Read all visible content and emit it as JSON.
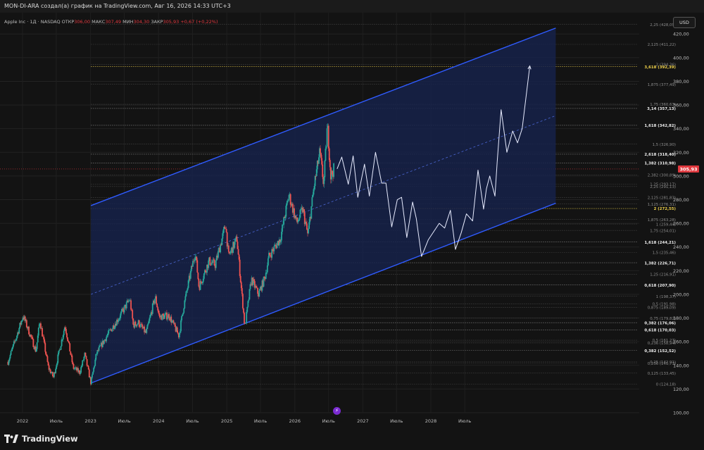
{
  "header": {
    "title": "MON-DI-ARA создал(а) график на TradingView.com, Авг 16, 2026 14:33 UTC+3"
  },
  "legend": {
    "symbol": "Apple Inc · 1Д · NASDAQ",
    "open_label": "ОТКР",
    "open_value": "306,00",
    "high_label": "МАКС",
    "high_value": "307,49",
    "low_label": "МИН",
    "low_value": "304,30",
    "close_label": "ЗАКР",
    "close_value": "305,93",
    "change": "+0,67 (+0,22%)"
  },
  "currency_button": "USD",
  "logo_text": "TradingView",
  "colors": {
    "background": "#131313",
    "channel_line": "#2f5bff",
    "channel_fill": "#16224a",
    "candle_up": "#26a69a",
    "candle_down": "#ef5350",
    "projection": "#e8ecff",
    "price_tag": "#e0383e",
    "fib_highlight": "#f0d24a"
  },
  "chart_data": {
    "type": "candlestick",
    "symbol": "AAPL",
    "timeframe": "1D",
    "ylim": [
      100,
      438
    ],
    "y_ticks": [
      "100,00",
      "120,00",
      "140,00",
      "160,00",
      "180,00",
      "200,00",
      "220,00",
      "240,00",
      "260,00",
      "280,00",
      "300,00",
      "320,00",
      "340,00",
      "360,00",
      "380,00",
      "400,00",
      "420,00"
    ],
    "x_ticks": [
      "2022",
      "Июль",
      "2023",
      "Июль",
      "2024",
      "Июль",
      "2025",
      "Июль",
      "2026",
      "Июль",
      "2027",
      "Июль",
      "2028",
      "Июль"
    ],
    "last_price": "305,93",
    "price_path": [
      [
        "2021-10-15",
        143
      ],
      [
        "2021-12-01",
        165
      ],
      [
        "2022-01-04",
        182
      ],
      [
        "2022-02-01",
        170
      ],
      [
        "2022-03-14",
        152
      ],
      [
        "2022-04-04",
        178
      ],
      [
        "2022-05-20",
        138
      ],
      [
        "2022-06-16",
        130
      ],
      [
        "2022-08-17",
        174
      ],
      [
        "2022-09-30",
        138
      ],
      [
        "2022-11-04",
        134
      ],
      [
        "2022-12-01",
        149
      ],
      [
        "2023-01-03",
        125
      ],
      [
        "2023-02-02",
        150
      ],
      [
        "2023-04-03",
        166
      ],
      [
        "2023-06-01",
        180
      ],
      [
        "2023-07-31",
        196
      ],
      [
        "2023-08-18",
        174
      ],
      [
        "2023-09-15",
        176
      ],
      [
        "2023-10-26",
        167
      ],
      [
        "2023-12-14",
        198
      ],
      [
        "2024-01-05",
        181
      ],
      [
        "2024-02-26",
        182
      ],
      [
        "2024-04-19",
        165
      ],
      [
        "2024-05-15",
        190
      ],
      [
        "2024-06-14",
        213
      ],
      [
        "2024-07-16",
        236
      ],
      [
        "2024-08-05",
        206
      ],
      [
        "2024-09-27",
        228
      ],
      [
        "2024-10-31",
        225
      ],
      [
        "2024-12-26",
        259
      ],
      [
        "2025-01-10",
        232
      ],
      [
        "2025-02-24",
        247
      ],
      [
        "2025-04-08",
        172
      ],
      [
        "2025-05-13",
        213
      ],
      [
        "2025-06-20",
        200
      ],
      [
        "2025-07-24",
        214
      ],
      [
        "2025-08-15",
        232
      ],
      [
        "2025-10-15",
        247
      ],
      [
        "2025-12-01",
        284
      ],
      [
        "2026-01-12",
        260
      ],
      [
        "2026-02-12",
        272
      ],
      [
        "2026-03-12",
        250
      ],
      [
        "2026-04-15",
        292
      ],
      [
        "2026-05-15",
        320
      ],
      [
        "2026-06-05",
        293
      ],
      [
        "2026-06-25",
        343
      ],
      [
        "2026-07-13",
        300
      ],
      [
        "2026-07-31",
        306
      ]
    ],
    "projection_path": [
      [
        "2026-08-16",
        306
      ],
      [
        "2026-09-10",
        316
      ],
      [
        "2026-10-15",
        293
      ],
      [
        "2026-11-10",
        317
      ],
      [
        "2026-12-05",
        282
      ],
      [
        "2027-01-10",
        310
      ],
      [
        "2027-02-05",
        283
      ],
      [
        "2027-03-10",
        320
      ],
      [
        "2027-04-12",
        294
      ],
      [
        "2027-05-05",
        294
      ],
      [
        "2027-06-05",
        257
      ],
      [
        "2027-07-05",
        280
      ],
      [
        "2027-07-28",
        282
      ],
      [
        "2027-08-25",
        248
      ],
      [
        "2027-09-25",
        278
      ],
      [
        "2027-10-15",
        264
      ],
      [
        "2027-11-12",
        232
      ],
      [
        "2027-12-18",
        246
      ],
      [
        "2028-02-15",
        260
      ],
      [
        "2028-03-15",
        256
      ],
      [
        "2028-04-15",
        271
      ],
      [
        "2028-05-12",
        238
      ],
      [
        "2028-06-12",
        252
      ],
      [
        "2028-07-10",
        268
      ],
      [
        "2028-08-12",
        262
      ],
      [
        "2028-09-10",
        305
      ],
      [
        "2028-10-10",
        272
      ],
      [
        "2028-10-25",
        289
      ],
      [
        "2028-11-12",
        300
      ],
      [
        "2028-12-10",
        283
      ],
      [
        "2028-12-22",
        312
      ],
      [
        "2029-01-12",
        356
      ],
      [
        "2029-02-12",
        320
      ],
      [
        "2029-03-15",
        338
      ],
      [
        "2029-04-10",
        328
      ],
      [
        "2029-05-05",
        340
      ],
      [
        "2029-06-15",
        393
      ]
    ],
    "channel": {
      "lower": [
        [
          "2023-01-03",
          125
        ],
        [
          "2029-11-01",
          277
        ]
      ],
      "upper": [
        [
          "2023-01-03",
          275
        ],
        [
          "2029-11-01",
          425
        ]
      ],
      "median": [
        [
          "2023-01-03",
          200
        ],
        [
          "2029-11-01",
          351
        ]
      ]
    },
    "fib_levels": [
      {
        "label": "2,25 (428,09)",
        "value": 428.09,
        "style": "dim"
      },
      {
        "label": "2,125 (411,22)",
        "value": 411.22,
        "style": "dim"
      },
      {
        "label": "2 (394,36)",
        "value": 394.36,
        "style": "dim"
      },
      {
        "label": "3,618 (392,39)",
        "value": 392.39,
        "style": "gold"
      },
      {
        "label": "1,875 (377,49)",
        "value": 377.49,
        "style": "dim"
      },
      {
        "label": "1,75 (360,63)",
        "value": 360.63,
        "style": "dim"
      },
      {
        "label": "3,14 (357,13)",
        "value": 357.13,
        "style": "bright"
      },
      {
        "label": "1,618 (342,82)",
        "value": 342.82,
        "style": "bright"
      },
      {
        "label": "1,5 (326,90)",
        "value": 326.9,
        "style": "dim"
      },
      {
        "label": "2,618 (318,40)",
        "value": 318.4,
        "style": "bright"
      },
      {
        "label": "1,382 (310,98)",
        "value": 310.98,
        "style": "bright"
      },
      {
        "label": "2,382 (300,89)",
        "value": 300.89,
        "style": "dim"
      },
      {
        "label": "1,25 (293,17)",
        "value": 293.17,
        "style": "dim"
      },
      {
        "label": "2,25 (291,13)",
        "value": 291.13,
        "style": "dim"
      },
      {
        "label": "2,125 (281,83)",
        "value": 281.83,
        "style": "dim"
      },
      {
        "label": "1,125 (276,31)",
        "value": 276.31,
        "style": "dim"
      },
      {
        "label": "2 (272,55)",
        "value": 272.55,
        "style": "gold"
      },
      {
        "label": "1,875 (263,28)",
        "value": 263.28,
        "style": "dim"
      },
      {
        "label": "1 (259,44)",
        "value": 259.44,
        "style": "dim"
      },
      {
        "label": "1,75 (254,01)",
        "value": 254.01,
        "style": "dim"
      },
      {
        "label": "1,618 (244,21)",
        "value": 244.21,
        "style": "bright"
      },
      {
        "label": "1,5 (235,46)",
        "value": 235.46,
        "style": "dim"
      },
      {
        "label": "1,382 (226,71)",
        "value": 226.71,
        "style": "bright"
      },
      {
        "label": "1,25 (216,91)",
        "value": 216.91,
        "style": "dim"
      },
      {
        "label": "0,618 (207,90)",
        "value": 207.9,
        "style": "bright"
      },
      {
        "label": "1 (198,37)",
        "value": 198.37,
        "style": "dim"
      },
      {
        "label": "0,5 (191,98)",
        "value": 191.98,
        "style": "dim"
      },
      {
        "label": "0,875 (189,09)",
        "value": 189.09,
        "style": "dim"
      },
      {
        "label": "0,75 (179,82)",
        "value": 179.82,
        "style": "dim"
      },
      {
        "label": "0,382 (176,06)",
        "value": 176.06,
        "style": "bright"
      },
      {
        "label": "0,618 (170,03)",
        "value": 170.03,
        "style": "bright"
      },
      {
        "label": "0,5 (161,27)",
        "value": 161.27,
        "style": "dim"
      },
      {
        "label": "0,236 (158,94)",
        "value": 158.94,
        "style": "dim"
      },
      {
        "label": "0,382 (152,52)",
        "value": 152.52,
        "style": "bright"
      },
      {
        "label": "0,25 (142,91)",
        "value": 142.91,
        "style": "dim"
      },
      {
        "label": "0,236 (141,73)",
        "value": 141.73,
        "style": "dim"
      },
      {
        "label": "0,125 (133,45)",
        "value": 133.45,
        "style": "dim"
      },
      {
        "label": "0 (124,18)",
        "value": 124.18,
        "style": "dim"
      }
    ],
    "grid": true,
    "legend_position": "top-left"
  }
}
